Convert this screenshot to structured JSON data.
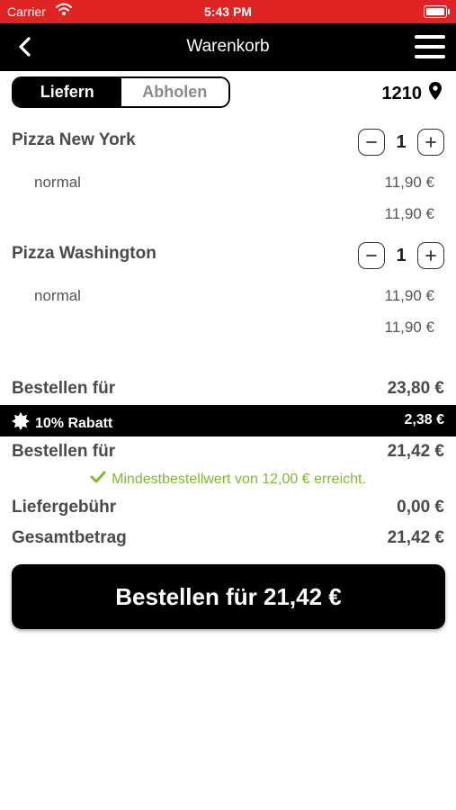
{
  "status_bar": {
    "carrier": "Carrier",
    "time": "5:43 PM"
  },
  "nav": {
    "title": "Warenkorb"
  },
  "delivery_toggle": {
    "options": [
      "Liefern",
      "Abholen"
    ],
    "selected": "Liefern"
  },
  "location": {
    "zip": "1210",
    "icon": "location-pin-icon"
  },
  "items": [
    {
      "name": "Pizza New York",
      "quantity": "1",
      "variant": "normal",
      "unit_price": "11,90 €",
      "line_total": "11,90 €"
    },
    {
      "name": "Pizza Washington",
      "quantity": "1",
      "variant": "normal",
      "unit_price": "11,90 €",
      "line_total": "11,90 €"
    }
  ],
  "summary": {
    "subtotal_label": "Bestellen für",
    "subtotal_value": "23,80 €",
    "discount_label": "10% Rabatt",
    "discount_value": "2,38 €",
    "after_discount_label": "Bestellen für",
    "after_discount_value": "21,42 €",
    "min_order_note": "Mindestbestellwert von 12,00 € erreicht.",
    "delivery_fee_label": "Liefergebühr",
    "delivery_fee_value": "0,00 €",
    "total_label": "Gesamtbetrag",
    "total_value": "21,42 €"
  },
  "order_button": {
    "label": "Bestellen für 21,42 €"
  },
  "colors": {
    "status_bar": "#e02424",
    "accent_green": "#7cbb2a",
    "primary": "#000000"
  }
}
